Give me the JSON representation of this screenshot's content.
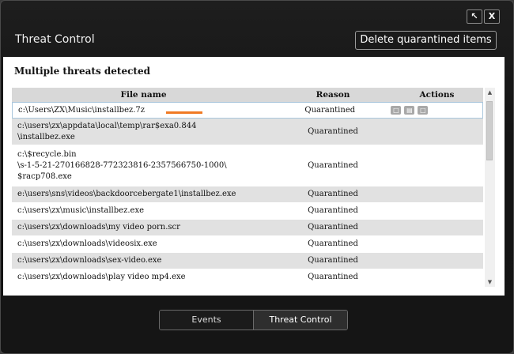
{
  "window": {
    "title": "Threat Control",
    "restore_glyph": "↖",
    "close_glyph": "X"
  },
  "toolbar": {
    "delete_label": "Delete quarantined items"
  },
  "panel": {
    "heading": "Multiple threats detected",
    "columns": {
      "file": "File name",
      "reason": "Reason",
      "actions": "Actions"
    },
    "rows": [
      {
        "file": "c:\\Users\\ZX\\Music\\installbez.7z",
        "reason": "Quarantined"
      },
      {
        "file": "c:\\users\\zx\\appdata\\local\\temp\\rar$exa0.844\n\\installbez.exe",
        "reason": "Quarantined"
      },
      {
        "file": "c:\\$recycle.bin\n\\s-1-5-21-270166828-772323816-2357566750-1000\\\n$racp708.exe",
        "reason": "Quarantined"
      },
      {
        "file": "e:\\users\\sns\\videos\\backdoorcebergate1\\installbez.exe",
        "reason": "Quarantined"
      },
      {
        "file": "c:\\users\\zx\\music\\installbez.exe",
        "reason": "Quarantined"
      },
      {
        "file": "c:\\users\\zx\\downloads\\my video porn.scr",
        "reason": "Quarantined"
      },
      {
        "file": "c:\\users\\zx\\downloads\\videosix.exe",
        "reason": "Quarantined"
      },
      {
        "file": "c:\\users\\zx\\downloads\\sex-video.exe",
        "reason": "Quarantined"
      },
      {
        "file": "c:\\users\\zx\\downloads\\play video mp4.exe",
        "reason": "Quarantined"
      }
    ],
    "action_icons": [
      "restore-icon",
      "delete-icon",
      "folder-icon"
    ]
  },
  "tabs": [
    {
      "label": "Events",
      "active": false
    },
    {
      "label": "Threat Control",
      "active": true
    }
  ],
  "colors": {
    "accent_underline": "#f07a24",
    "selected_row_border": "#a9c6dc"
  }
}
